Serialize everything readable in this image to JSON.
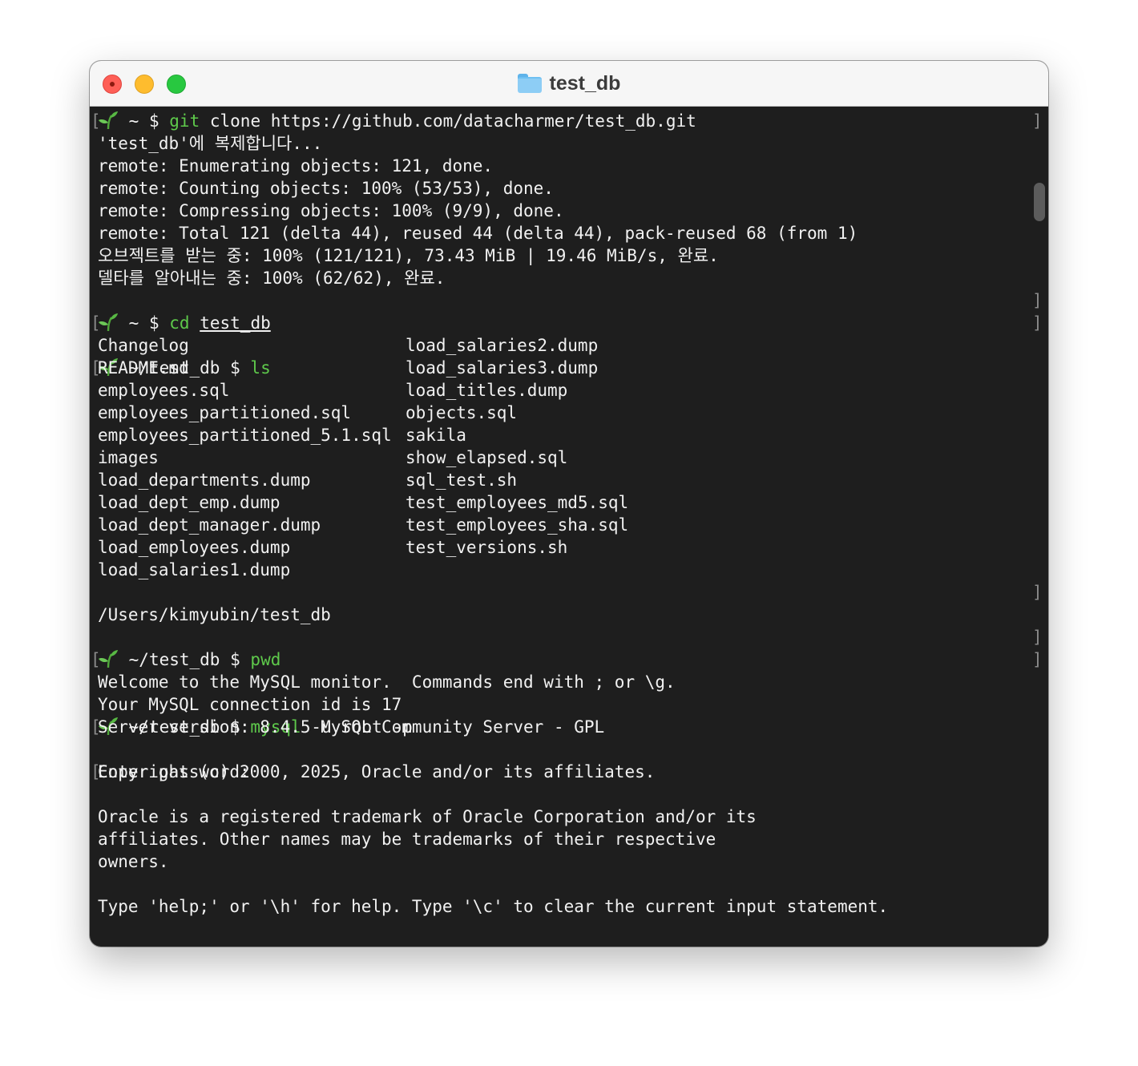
{
  "window": {
    "title": "test_db",
    "title_icon": "folder-icon",
    "controls": [
      "close",
      "minimize",
      "maximize"
    ]
  },
  "colors": {
    "terminal_bg": "#1e1e1e",
    "text": "#f1f1f1",
    "command": "#5ec94b",
    "bracket": "#8a8a8a",
    "titlebar_bg": "#f6f6f6"
  },
  "prompt_icon": "sprout-icon",
  "session": {
    "p1": {
      "path": "~",
      "symbol": "$",
      "cmd": "git",
      "args": "clone https://github.com/datacharmer/test_db.git"
    },
    "clone_output": [
      "'test_db'에 복제합니다...",
      "remote: Enumerating objects: 121, done.",
      "remote: Counting objects: 100% (53/53), done.",
      "remote: Compressing objects: 100% (9/9), done.",
      "remote: Total 121 (delta 44), reused 44 (delta 44), pack-reused 68 (from 1)",
      "오브젝트를 받는 중: 100% (121/121), 73.43 MiB | 19.46 MiB/s, 완료.",
      "델타를 알아내는 중: 100% (62/62), 완료."
    ],
    "p2": {
      "path": "~",
      "symbol": "$",
      "cmd": "cd",
      "args": "test_db"
    },
    "p3": {
      "path": "~/test_db",
      "symbol": "$",
      "cmd": "ls"
    },
    "ls_left": [
      "Changelog",
      "README.md",
      "employees.sql",
      "employees_partitioned.sql",
      "employees_partitioned_5.1.sql",
      "images",
      "load_departments.dump",
      "load_dept_emp.dump",
      "load_dept_manager.dump",
      "load_employees.dump",
      "load_salaries1.dump"
    ],
    "ls_right": [
      "load_salaries2.dump",
      "load_salaries3.dump",
      "load_titles.dump",
      "objects.sql",
      "sakila",
      "show_elapsed.sql",
      "sql_test.sh",
      "test_employees_md5.sql",
      "test_employees_sha.sql",
      "test_versions.sh"
    ],
    "p4": {
      "path": "~/test_db",
      "symbol": "$",
      "cmd": "pwd"
    },
    "pwd_output": "/Users/kimyubin/test_db",
    "p5": {
      "path": "~/test_db",
      "symbol": "$",
      "cmd": "mysql",
      "args": "-u root -p"
    },
    "password_prompt": "Enter password:",
    "mysql_output": [
      "Welcome to the MySQL monitor.  Commands end with ; or \\g.",
      "Your MySQL connection id is 17",
      "Server version: 8.4.5 MySQL Community Server - GPL",
      "",
      "Copyright (c) 2000, 2025, Oracle and/or its affiliates.",
      "",
      "Oracle is a registered trademark of Oracle Corporation and/or its",
      "affiliates. Other names may be trademarks of their respective",
      "owners.",
      "",
      "Type 'help;' or '\\h' for help. Type '\\c' to clear the current input statement."
    ]
  }
}
